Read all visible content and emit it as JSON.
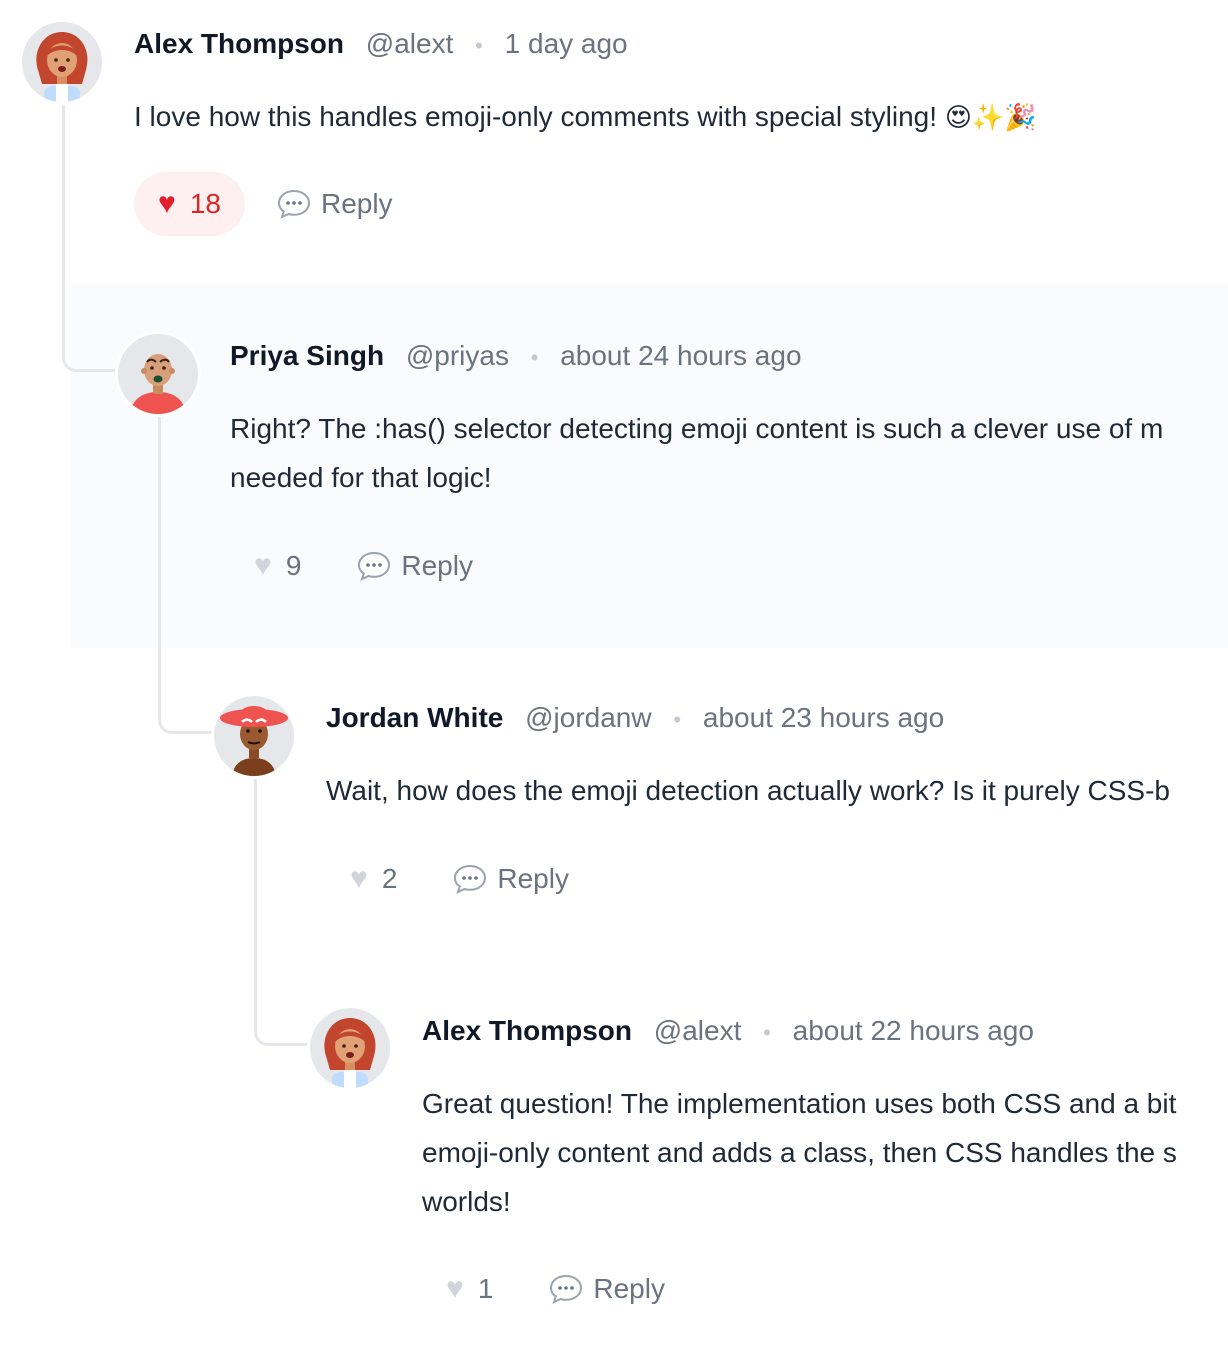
{
  "comments": [
    {
      "author": "Alex Thompson",
      "handle": "@alext",
      "separator": "•",
      "time": "1 day ago",
      "text": "I love how this handles emoji-only comments with special styling!",
      "emoji": "😍✨🎉",
      "likes": "18",
      "liked": true,
      "reply_label": "Reply"
    },
    {
      "author": "Priya Singh",
      "handle": "@priyas",
      "separator": "•",
      "time": "about 24 hours ago",
      "text_lines": [
        "Right? The :has() selector detecting emoji content is such a clever use of m",
        "needed for that logic!"
      ],
      "likes": "9",
      "liked": false,
      "reply_label": "Reply"
    },
    {
      "author": "Jordan White",
      "handle": "@jordanw",
      "separator": "•",
      "time": "about 23 hours ago",
      "text": "Wait, how does the emoji detection actually work? Is it purely CSS-b",
      "likes": "2",
      "liked": false,
      "reply_label": "Reply"
    },
    {
      "author": "Alex Thompson",
      "handle": "@alext",
      "separator": "•",
      "time": "about 22 hours ago",
      "text_lines": [
        "Great question! The implementation uses both CSS and a bit",
        "emoji-only content and adds a class, then CSS handles the s",
        "worlds!"
      ],
      "likes": "1",
      "liked": false,
      "reply_label": "Reply"
    }
  ],
  "icons": {
    "heart_filled": "heart-filled-icon",
    "heart_outline": "heart-outline-icon",
    "reply": "speech-bubble-icon"
  },
  "colors": {
    "liked": "#dc2626",
    "liked_bg": "#fef0f0",
    "muted": "#6b7280",
    "thread_line": "#e5e7eb",
    "reply_band": "#fafbfc"
  }
}
